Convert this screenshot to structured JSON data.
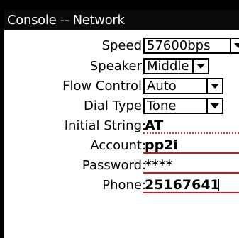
{
  "title": "Console -- Network",
  "fields": {
    "speed": {
      "label": "Speed",
      "value": "57600bps"
    },
    "speaker": {
      "label": "Speaker",
      "value": "Middle"
    },
    "flow_control": {
      "label": "Flow Control",
      "value": "Auto"
    },
    "dial_type": {
      "label": "Dial Type",
      "value": "Tone"
    },
    "initial_string": {
      "label": "Initial String",
      "value": "AT"
    },
    "account": {
      "label": "Account",
      "value": "pp2i"
    },
    "password": {
      "label": "Password",
      "value": "****"
    },
    "phone": {
      "label": "Phone",
      "value": "25167641"
    }
  },
  "colon": ":",
  "colors": {
    "underline": "#e01010",
    "titlebar": "#0a0a0a"
  }
}
